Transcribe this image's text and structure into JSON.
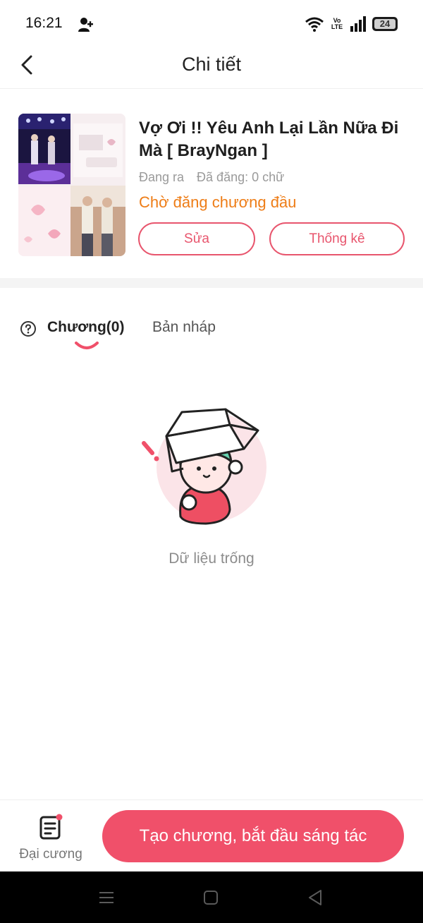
{
  "status_bar": {
    "time": "16:21",
    "network": "Vo LTE",
    "battery": "24"
  },
  "header": {
    "title": "Chi tiết"
  },
  "story": {
    "title": "Vợ Ơi !! Yêu Anh Lại Lần Nữa Đi Mà [ BrayNgan ]",
    "status": "Đang ra",
    "word_count": "Đã đăng: 0 chữ",
    "pending_label": "Chờ đăng chương đầu",
    "edit_label": "Sửa",
    "stats_label": "Thống kê"
  },
  "tabs": [
    {
      "label": "Chương(0)",
      "active": true
    },
    {
      "label": "Bản nháp",
      "active": false
    }
  ],
  "empty_state": {
    "text": "Dữ liệu trống"
  },
  "bottom_bar": {
    "outline_label": "Đại cương",
    "create_label": "Tạo chương, bắt đầu sáng tác"
  },
  "colors": {
    "accent": "#f0506a",
    "pending": "#ee7d17",
    "outline_border": "#e8556d"
  },
  "icons": [
    "person-add-icon",
    "wifi-icon",
    "signal-icon",
    "battery-icon",
    "back-arrow-icon",
    "help-icon",
    "document-icon",
    "nav-menu-icon",
    "nav-home-icon",
    "nav-back-icon"
  ]
}
